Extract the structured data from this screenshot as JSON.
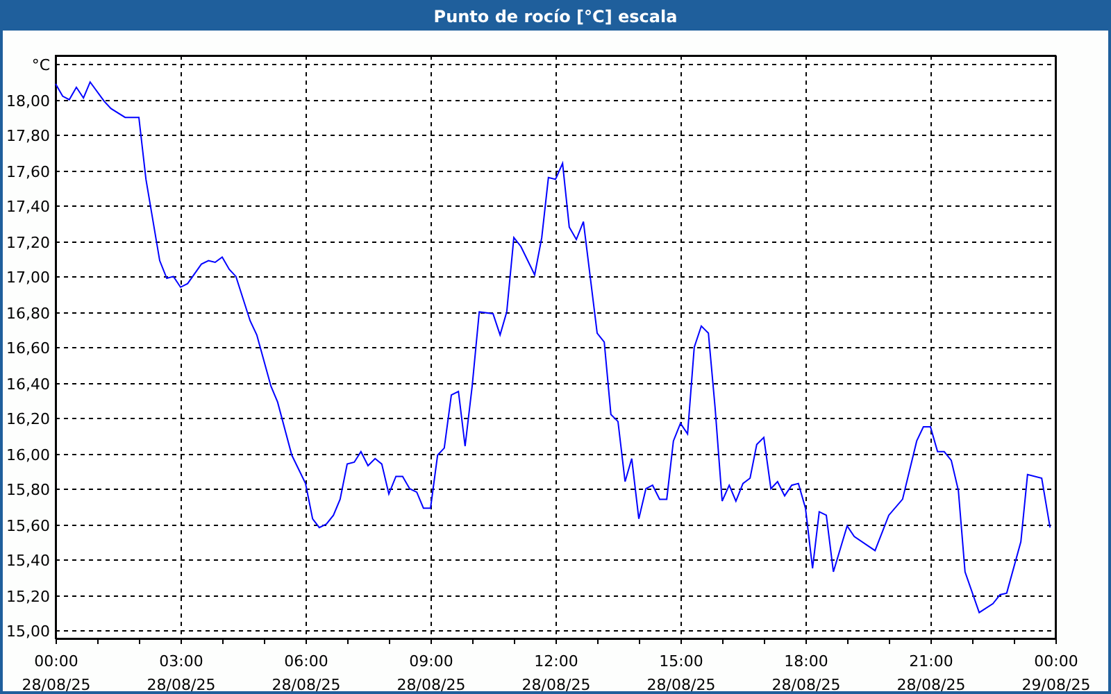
{
  "window": {
    "title": "Punto de rocío [°C] escala"
  },
  "chart": {
    "date_labels": [
      "28/08/25",
      "28/08/25",
      "28/08/25",
      "28/08/25",
      "28/08/25",
      "28/08/25",
      "28/08/25",
      "28/08/25",
      "29/08/25"
    ],
    "chart_data": {
      "type": "line",
      "grid": true,
      "ylabel": "°C",
      "xlim": [
        0,
        24
      ],
      "ylim": [
        14.953,
        18.25
      ],
      "xticks": [
        {
          "value": 0,
          "label": "00:00"
        },
        {
          "value": 3,
          "label": "03:00"
        },
        {
          "value": 6,
          "label": "06:00"
        },
        {
          "value": 9,
          "label": "09:00"
        },
        {
          "value": 12,
          "label": "12:00"
        },
        {
          "value": 15,
          "label": "15:00"
        },
        {
          "value": 18,
          "label": "18:00"
        },
        {
          "value": 21,
          "label": "21:00"
        },
        {
          "value": 24,
          "label": "00:00"
        }
      ],
      "yticks": [
        {
          "value": 15,
          "label": "15,00"
        },
        {
          "value": 15.2,
          "label": "15,20"
        },
        {
          "value": 15.4,
          "label": "15,40"
        },
        {
          "value": 15.6,
          "label": "15,60"
        },
        {
          "value": 15.8,
          "label": "15,80"
        },
        {
          "value": 16,
          "label": "16,00"
        },
        {
          "value": 16.2,
          "label": "16,20"
        },
        {
          "value": 16.4,
          "label": "16,40"
        },
        {
          "value": 16.6,
          "label": "16,60"
        },
        {
          "value": 16.8,
          "label": "16,80"
        },
        {
          "value": 17,
          "label": "17,00"
        },
        {
          "value": 17.2,
          "label": "17,20"
        },
        {
          "value": 17.4,
          "label": "17,40"
        },
        {
          "value": 17.6,
          "label": "17,60"
        },
        {
          "value": 17.8,
          "label": "17,80"
        },
        {
          "value": 18,
          "label": "18,00"
        }
      ],
      "x": [
        0,
        0.17,
        0.33,
        0.5,
        0.67,
        0.83,
        1.17,
        1.33,
        1.67,
        2,
        2.17,
        2.5,
        2.67,
        2.83,
        3,
        3.17,
        3.5,
        3.67,
        3.83,
        4,
        4.17,
        4.33,
        4.67,
        4.83,
        5.17,
        5.33,
        5.67,
        6,
        6.17,
        6.33,
        6.5,
        6.67,
        6.83,
        7,
        7.17,
        7.33,
        7.5,
        7.67,
        7.83,
        8,
        8.17,
        8.33,
        8.5,
        8.67,
        8.83,
        9,
        9.17,
        9.33,
        9.5,
        9.67,
        9.83,
        10,
        10.17,
        10.5,
        10.67,
        10.83,
        11,
        11.17,
        11.5,
        11.67,
        11.83,
        12,
        12.17,
        12.33,
        12.5,
        12.67,
        13,
        13.17,
        13.33,
        13.5,
        13.67,
        13.83,
        14,
        14.17,
        14.33,
        14.5,
        14.67,
        14.83,
        15,
        15.17,
        15.33,
        15.5,
        15.67,
        15.83,
        16,
        16.17,
        16.33,
        16.5,
        16.67,
        16.83,
        17,
        17.17,
        17.33,
        17.5,
        17.67,
        17.83,
        18,
        18.17,
        18.33,
        18.5,
        18.67,
        19,
        19.17,
        19.67,
        20,
        20.33,
        20.67,
        20.83,
        21,
        21.17,
        21.33,
        21.5,
        21.67,
        21.83,
        22.17,
        22.5,
        22.67,
        22.83,
        23.17,
        23.33,
        23.67,
        23.87
      ],
      "series": [
        {
          "color": "#0000ff",
          "values": [
            18.09,
            18.02,
            18.0,
            18.07,
            18.01,
            18.1,
            17.99,
            17.95,
            17.9,
            17.9,
            17.55,
            17.09,
            16.99,
            17.0,
            16.94,
            16.96,
            17.07,
            17.09,
            17.08,
            17.11,
            17.04,
            17.0,
            16.75,
            16.67,
            16.38,
            16.29,
            15.99,
            15.83,
            15.63,
            15.58,
            15.6,
            15.65,
            15.74,
            15.94,
            15.95,
            16.01,
            15.93,
            15.97,
            15.94,
            15.77,
            15.87,
            15.87,
            15.8,
            15.78,
            15.69,
            15.69,
            15.99,
            16.03,
            16.33,
            16.35,
            16.04,
            16.38,
            16.8,
            16.79,
            16.67,
            16.8,
            17.22,
            17.17,
            17.01,
            17.22,
            17.56,
            17.55,
            17.64,
            17.28,
            17.21,
            17.31,
            16.68,
            16.63,
            16.22,
            16.18,
            15.84,
            15.97,
            15.63,
            15.8,
            15.82,
            15.74,
            15.74,
            16.07,
            16.17,
            16.11,
            16.6,
            16.72,
            16.68,
            16.26,
            15.73,
            15.82,
            15.73,
            15.83,
            15.86,
            16.05,
            16.09,
            15.8,
            15.84,
            15.76,
            15.82,
            15.83,
            15.69,
            15.35,
            15.67,
            15.65,
            15.33,
            15.59,
            15.53,
            15.45,
            15.65,
            15.74,
            16.07,
            16.15,
            16.15,
            16.01,
            16.01,
            15.96,
            15.79,
            15.33,
            15.1,
            15.15,
            15.2,
            15.21,
            15.5,
            15.88,
            15.86,
            15.58
          ]
        }
      ]
    }
  }
}
